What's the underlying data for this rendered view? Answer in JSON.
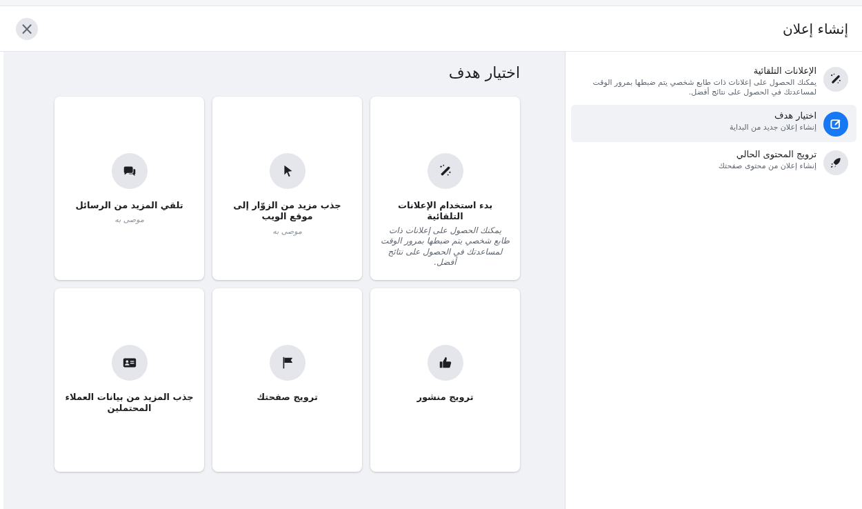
{
  "window": {
    "title": "إنشاء إعلان",
    "close": "×"
  },
  "sidebar": {
    "items": [
      {
        "title": "الإعلانات التلقائية",
        "description": "يمكنك الحصول على إعلانات ذات طابع شخصي يتم ضبطها بمرور الوقت لمساعدتك في الحصول على نتائج أفضل.",
        "selected": false
      },
      {
        "title": "اختيار هدف",
        "description": "إنشاء إعلان جديد من البداية",
        "selected": true
      },
      {
        "title": "ترويج المحتوى الحالي",
        "description": "إنشاء إعلان من محتوى صفحتك",
        "selected": false
      }
    ]
  },
  "main": {
    "heading": "اختيار هدف",
    "cards": [
      {
        "title": "بدء استخدام الإعلانات التلقائية",
        "description": "يمكنك الحصول على إعلانات ذات طابع شخصي يتم ضبطها بمرور الوقت لمساعدتك في الحصول على نتائج أفضل."
      },
      {
        "title": "جذب مزيد من الزوّار إلى موقع الويب",
        "note": "موصى به"
      },
      {
        "title": "تلقي المزيد من الرسائل",
        "note": "موصى به"
      },
      {
        "title": "ترويج منشور"
      },
      {
        "title": "ترويج صفحتك"
      },
      {
        "title": "جذب المزيد من بيانات العملاء المحتملين"
      }
    ]
  }
}
